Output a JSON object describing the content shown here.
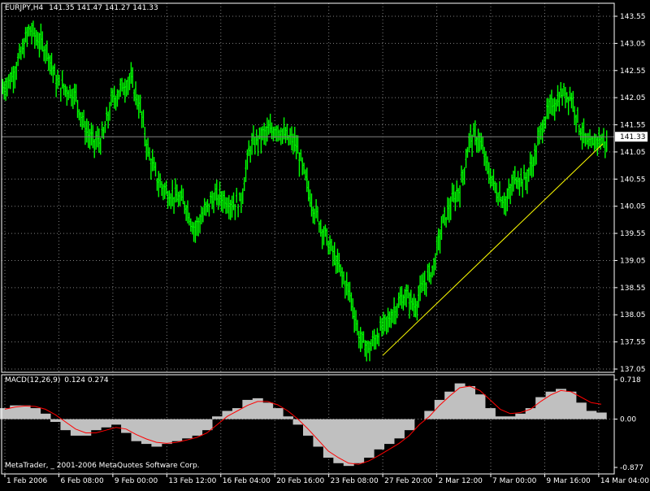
{
  "header": {
    "symbol": "EURJPY,H4",
    "open": "141.35",
    "high": "141.47",
    "low": "141.27",
    "close": "141.33"
  },
  "macd_header": {
    "label": "MACD(12,26,9)",
    "main": "0.124",
    "signal": "0.274"
  },
  "footer": {
    "copyright": "MetaTrader, _ 2001-2006 MetaQuotes Software Corp."
  },
  "colors": {
    "background": "#000000",
    "grid": "#808080",
    "candle": "#00ff00",
    "trendline": "#ffff00",
    "histogram": "#c0c0c0",
    "signal_line": "#ff0000",
    "bid_line": "#808080",
    "text": "#ffffff"
  },
  "chart_data": [
    {
      "type": "line",
      "title": "EURJPY,H4",
      "series_kind": "ohlc-bars",
      "ylim": [
        137.05,
        143.55
      ],
      "y_ticks": [
        "143.55",
        "143.05",
        "142.55",
        "142.05",
        "141.55",
        "141.05",
        "140.55",
        "140.05",
        "139.55",
        "139.05",
        "138.55",
        "138.05",
        "137.55",
        "137.05"
      ],
      "x_ticks": [
        "1 Feb 2006",
        "6 Feb 08:00",
        "9 Feb 00:00",
        "13 Feb 12:00",
        "16 Feb 04:00",
        "20 Feb 16:00",
        "23 Feb 08:00",
        "27 Feb 20:00",
        "2 Mar 12:00",
        "7 Mar 00:00",
        "9 Mar 16:00",
        "14 Mar 04:00"
      ],
      "current_price": "141.33",
      "series": [
        {
          "close": [
            142.4,
            142.8,
            143.3,
            143.1,
            142.9,
            142.3,
            142.2,
            142.1,
            141.5,
            141.2,
            141.3,
            142.0,
            142.2,
            142.4,
            141.9,
            141.0,
            140.5,
            140.3,
            140.2,
            140.1,
            139.6,
            139.9,
            140.2,
            140.2,
            140.1,
            140.1,
            141.1,
            141.3,
            141.4,
            141.5,
            141.3,
            141.2,
            140.6,
            140.0,
            139.6,
            139.2,
            138.8,
            138.4,
            137.6,
            137.4,
            137.7,
            137.9,
            138.2,
            138.4,
            138.2,
            138.6,
            138.9,
            139.7,
            140.1,
            140.4,
            141.3,
            141.3,
            140.7,
            140.3,
            140.1,
            140.6,
            140.5,
            140.9,
            141.6,
            141.9,
            142.1,
            142.1,
            141.5,
            141.1,
            141.3,
            141.2
          ],
          "trendline": [
            [
              137.3,
              41
            ],
            [
              141.2,
              65
            ]
          ]
        }
      ]
    },
    {
      "type": "bar",
      "title": "MACD(12,26,9) 0.124 0.274",
      "ylim": [
        -0.877,
        0.718
      ],
      "y_ticks": [
        "0.718",
        "0.00",
        "-0.877"
      ],
      "series": [
        {
          "name": "MACD",
          "kind": "histogram",
          "values": [
            0.2,
            0.25,
            0.25,
            0.2,
            0.1,
            -0.05,
            -0.2,
            -0.3,
            -0.3,
            -0.2,
            -0.15,
            -0.1,
            -0.25,
            -0.4,
            -0.45,
            -0.5,
            -0.45,
            -0.4,
            -0.35,
            -0.3,
            -0.2,
            0.05,
            0.15,
            0.2,
            0.35,
            0.38,
            0.3,
            0.2,
            0.05,
            -0.1,
            -0.3,
            -0.5,
            -0.7,
            -0.8,
            -0.85,
            -0.8,
            -0.7,
            -0.55,
            -0.45,
            -0.35,
            -0.2,
            0.0,
            0.15,
            0.35,
            0.5,
            0.65,
            0.6,
            0.45,
            0.2,
            0.05,
            0.05,
            0.1,
            0.2,
            0.4,
            0.5,
            0.55,
            0.5,
            0.3,
            0.15,
            0.12
          ]
        },
        {
          "name": "Signal",
          "kind": "line",
          "values": [
            0.18,
            0.22,
            0.24,
            0.23,
            0.18,
            0.08,
            -0.05,
            -0.18,
            -0.25,
            -0.25,
            -0.2,
            -0.15,
            -0.18,
            -0.28,
            -0.36,
            -0.42,
            -0.44,
            -0.42,
            -0.38,
            -0.33,
            -0.25,
            -0.1,
            0.05,
            0.15,
            0.25,
            0.32,
            0.32,
            0.26,
            0.15,
            0.0,
            -0.18,
            -0.38,
            -0.58,
            -0.7,
            -0.8,
            -0.82,
            -0.76,
            -0.66,
            -0.55,
            -0.44,
            -0.3,
            -0.1,
            0.05,
            0.25,
            0.42,
            0.57,
            0.6,
            0.52,
            0.35,
            0.18,
            0.1,
            0.12,
            0.18,
            0.32,
            0.44,
            0.52,
            0.5,
            0.4,
            0.3,
            0.27
          ]
        }
      ]
    }
  ]
}
